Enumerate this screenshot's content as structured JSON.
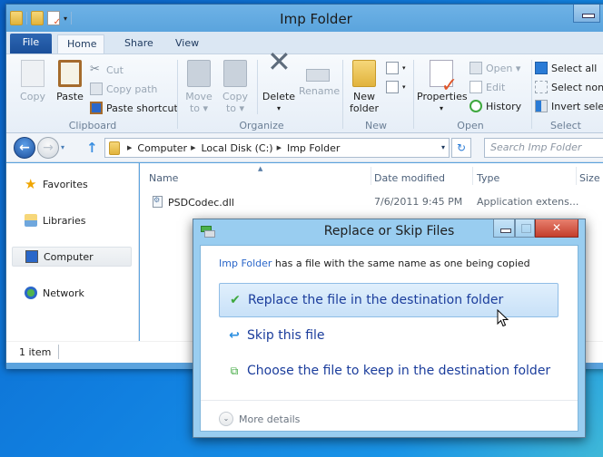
{
  "explorer": {
    "title": "Imp Folder",
    "qat_dropdown": "▾",
    "tabs": [
      {
        "label": "File"
      },
      {
        "label": "Home",
        "active": true
      },
      {
        "label": "Share"
      },
      {
        "label": "View"
      }
    ],
    "ribbon": {
      "clipboard": {
        "label": "Clipboard",
        "copy": "Copy",
        "paste": "Paste",
        "cut": "Cut",
        "copy_path": "Copy path",
        "paste_shortcut": "Paste shortcut"
      },
      "organize": {
        "label": "Organize",
        "move_to": [
          "Move",
          "to ▾"
        ],
        "copy_to": [
          "Copy",
          "to ▾"
        ],
        "delete": "Delete",
        "delete_dd": "▾",
        "rename": "Rename"
      },
      "new": {
        "label": "New",
        "new_folder": [
          "New",
          "folder"
        ]
      },
      "open": {
        "label": "Open",
        "properties": "Properties",
        "properties_dd": "▾",
        "open": "Open ▾",
        "edit": "Edit",
        "history": "History"
      },
      "select": {
        "label": "Select",
        "select_all": "Select all",
        "select_none": "Select none",
        "invert_selection": "Invert selection"
      }
    },
    "nav": {
      "back": "←",
      "forward": "→",
      "recent_dd": "▾",
      "up": "↑",
      "breadcrumb": [
        "Computer",
        "Local Disk (C:)",
        "Imp Folder"
      ],
      "crumb_sep": "▶",
      "address_dd": "▾",
      "refresh": "↻",
      "search_placeholder": "Search Imp Folder"
    },
    "nav_pane": [
      {
        "label": "Favorites",
        "icon": "star-icon"
      },
      {
        "label": "Libraries",
        "icon": "libraries-icon"
      },
      {
        "label": "Computer",
        "icon": "computer-icon",
        "selected": true
      },
      {
        "label": "Network",
        "icon": "network-icon"
      }
    ],
    "columns": [
      "Name",
      "Date modified",
      "Type",
      "Size"
    ],
    "sort_indicator": "▲",
    "files": [
      {
        "name": "PSDCodec.dll",
        "date_modified": "7/6/2011 9:45 PM",
        "type": "Application extens...",
        "size": ""
      }
    ],
    "status": "1 item"
  },
  "dialog": {
    "title": "Replace or Skip Files",
    "close": "✕",
    "message_link": "Imp Folder",
    "message_rest": " has a file with the same name as one being copied",
    "options": [
      {
        "label": "Replace the file in the destination folder",
        "icon": "✔"
      },
      {
        "label": "Skip this file",
        "icon": "↩"
      },
      {
        "label": "Choose the file to keep in the destination folder",
        "icon": "⧉"
      }
    ],
    "more_details": "More details",
    "more_chevron": "⌄"
  }
}
